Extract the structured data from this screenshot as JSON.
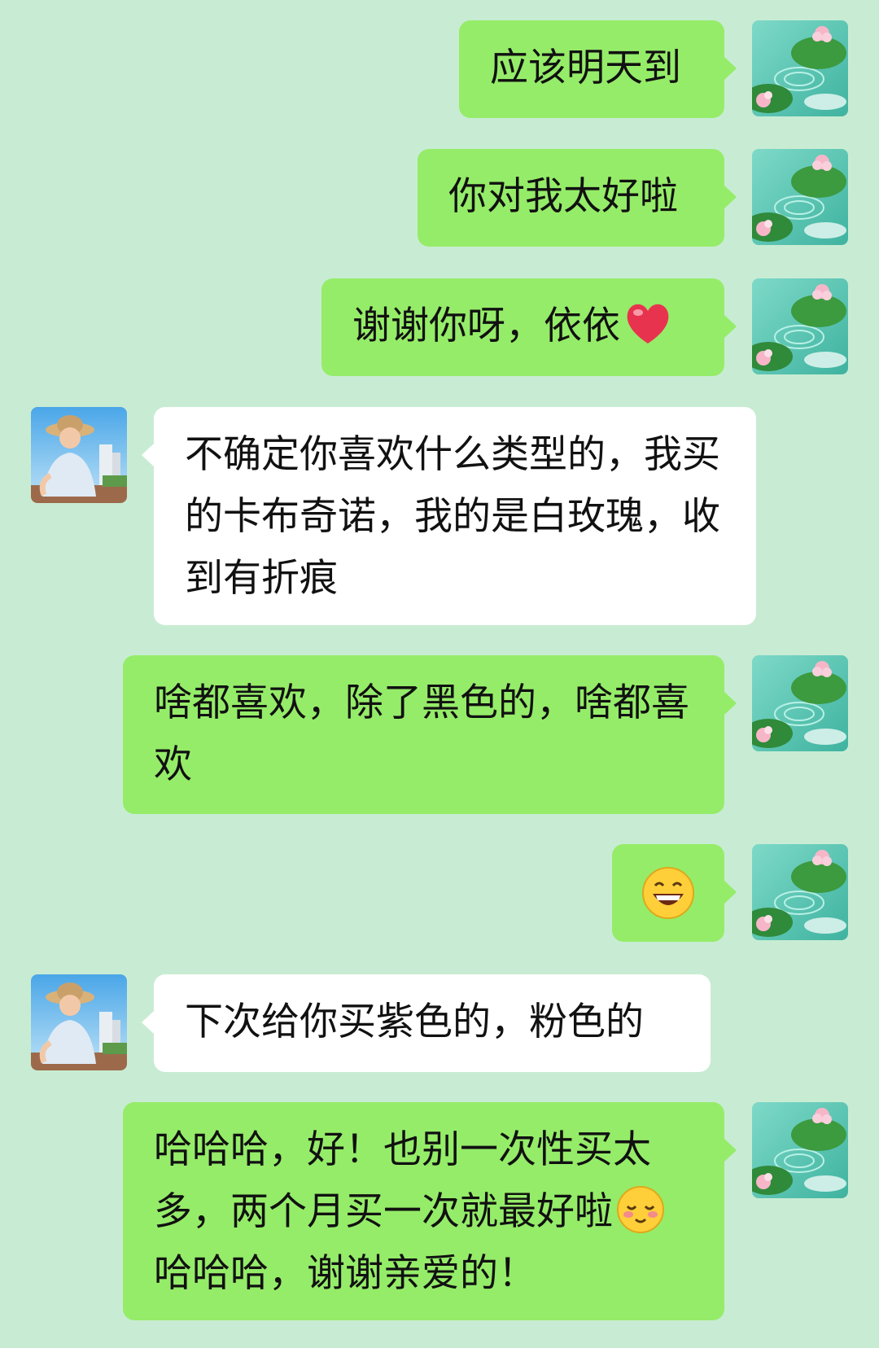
{
  "chat": {
    "background_color": "#c8ecd3",
    "outgoing_bubble_color": "#95ec69",
    "incoming_bubble_color": "#ffffff",
    "self_avatar": "lotus-pond-avatar",
    "contact_avatar": "woman-straw-hat-avatar",
    "messages": [
      {
        "direction": "outgoing",
        "text": "应该明天到"
      },
      {
        "direction": "outgoing",
        "text": "你对我太好啦"
      },
      {
        "direction": "outgoing",
        "text": "谢谢你呀，依依",
        "emoji": "red-heart-emoji"
      },
      {
        "direction": "incoming",
        "text": "不确定你喜欢什么类型的，我买的卡布奇诺，我的是白玫瑰，收到有折痕"
      },
      {
        "direction": "outgoing",
        "text": "啥都喜欢，除了黑色的，啥都喜欢"
      },
      {
        "direction": "outgoing",
        "emoji": "grinning-face-emoji"
      },
      {
        "direction": "incoming",
        "text": "下次给你买紫色的，粉色的"
      },
      {
        "direction": "outgoing",
        "text": "哈哈哈，好！也别一次性买太多，两个月买一次就最好啦",
        "emoji": "shy-smiling-face-emoji",
        "text_after": "哈哈哈，谢谢亲爱的！"
      }
    ]
  }
}
